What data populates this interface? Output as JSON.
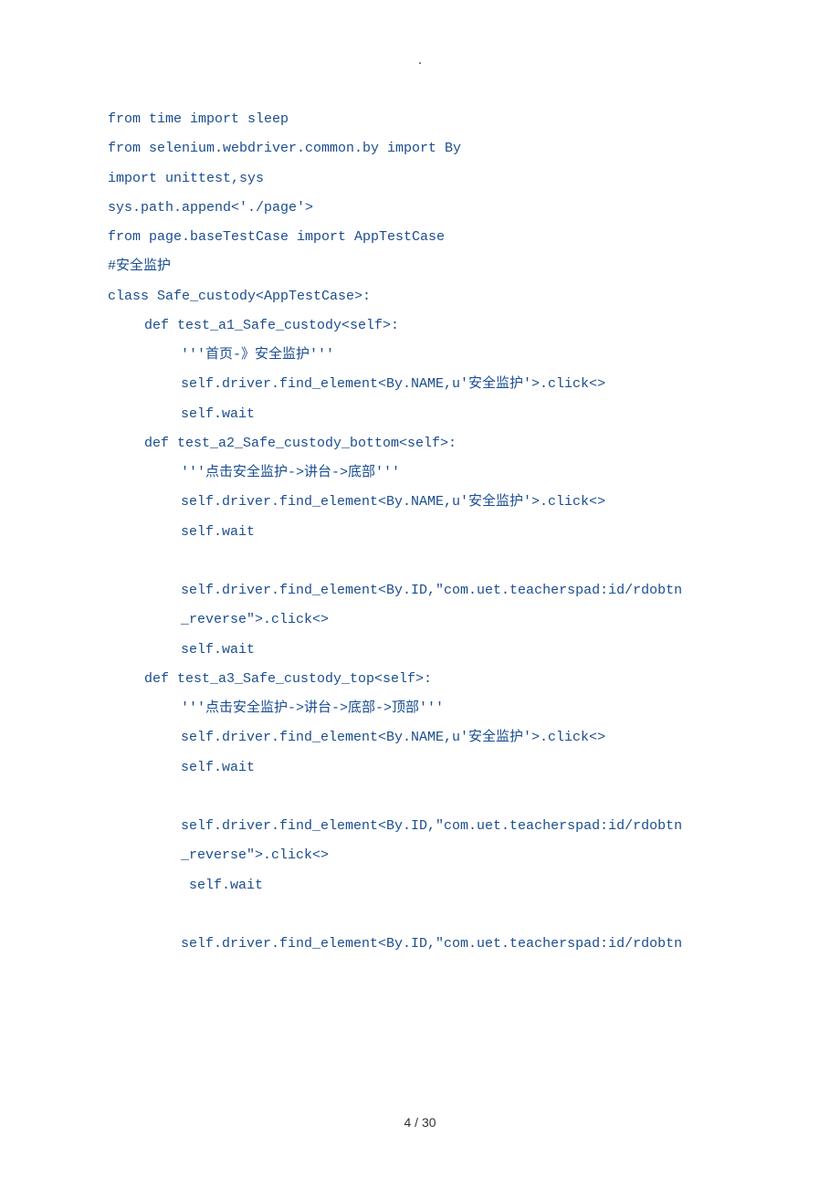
{
  "header_marker": ".",
  "code_lines": [
    {
      "text": "from time import sleep",
      "indent": 0
    },
    {
      "text": "from selenium.webdriver.common.by import By",
      "indent": 0
    },
    {
      "text": "import unittest,sys",
      "indent": 0
    },
    {
      "text": "sys.path.append<'./page'>",
      "indent": 0
    },
    {
      "text": "from page.baseTestCase import AppTestCase",
      "indent": 0
    },
    {
      "text": "#安全监护",
      "indent": 0
    },
    {
      "text": "class Safe_custody<AppTestCase>:",
      "indent": 0
    },
    {
      "text": "def test_a1_Safe_custody<self>:",
      "indent": 1
    },
    {
      "text": "'''首页-》安全监护'''",
      "indent": 2
    },
    {
      "text": "self.driver.find_element<By.NAME,u'安全监护'>.click<>",
      "indent": 2
    },
    {
      "text": "self.wait",
      "indent": 2
    },
    {
      "text": "def test_a2_Safe_custody_bottom<self>:",
      "indent": 1
    },
    {
      "text": "'''点击安全监护->讲台->底部'''",
      "indent": 2
    },
    {
      "text": "self.driver.find_element<By.NAME,u'安全监护'>.click<>",
      "indent": 2
    },
    {
      "text": "self.wait",
      "indent": 2
    },
    {
      "text": "",
      "indent": 0,
      "blank": true
    },
    {
      "text": "self.driver.find_element<By.ID,\"com.uet.teacherspad:id/rdobtn",
      "indent": 2
    },
    {
      "text": "_reverse\">.click<>",
      "indent": 2,
      "continuation": true
    },
    {
      "text": "self.wait",
      "indent": 2
    },
    {
      "text": "def test_a3_Safe_custody_top<self>:",
      "indent": 1
    },
    {
      "text": "'''点击安全监护->讲台->底部->顶部'''",
      "indent": 2
    },
    {
      "text": "self.driver.find_element<By.NAME,u'安全监护'>.click<>",
      "indent": 2
    },
    {
      "text": "self.wait",
      "indent": 2
    },
    {
      "text": "",
      "indent": 0,
      "blank": true
    },
    {
      "text": "self.driver.find_element<By.ID,\"com.uet.teacherspad:id/rdobtn",
      "indent": 2
    },
    {
      "text": "_reverse\">.click<>",
      "indent": 2,
      "continuation": true
    },
    {
      "text": " self.wait",
      "indent": 2
    },
    {
      "text": "",
      "indent": 0,
      "blank": true
    },
    {
      "text": "self.driver.find_element<By.ID,\"com.uet.teacherspad:id/rdobtn",
      "indent": 2
    }
  ],
  "page_number": "4 / 30"
}
